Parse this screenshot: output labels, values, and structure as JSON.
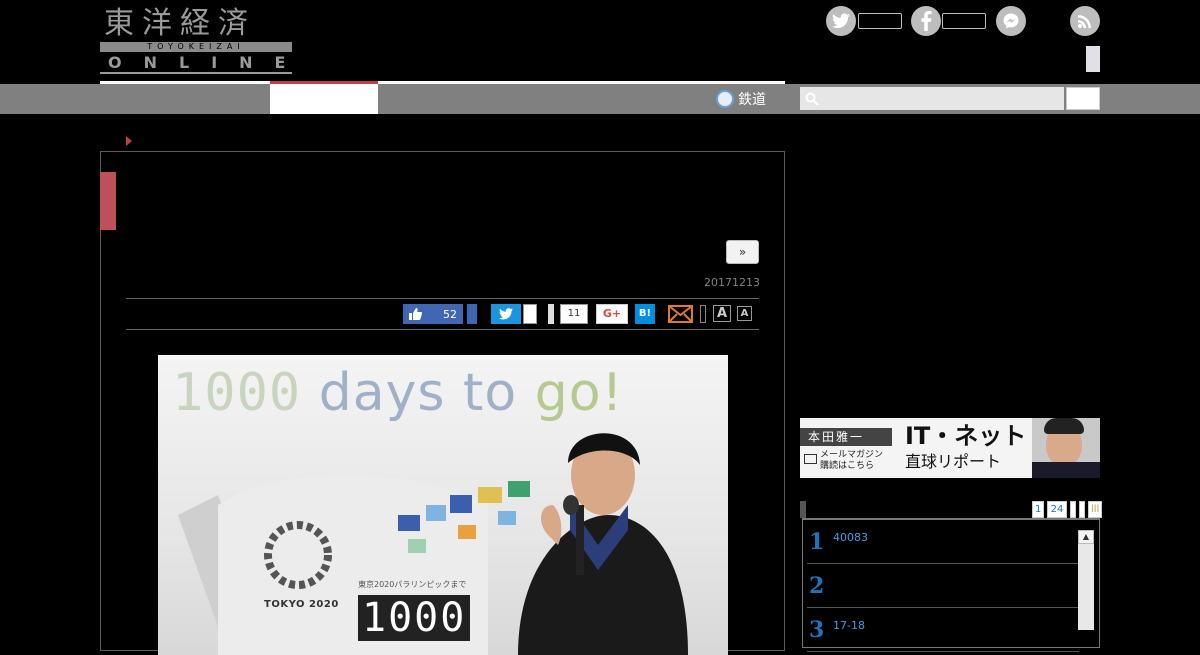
{
  "header": {
    "logo": {
      "kanji": "東洋経済",
      "romaji": "TOYOKEIZAI",
      "online": "ONLINE"
    },
    "social": {
      "twitter_icon": "twitter-icon",
      "facebook_icon": "facebook-icon",
      "messenger_icon": "messenger-icon",
      "rss_icon": "rss-icon"
    }
  },
  "nav": {
    "tetsudo_label": "鉄道",
    "search": {
      "placeholder": ""
    },
    "colors": {
      "accent": "#c0404a",
      "bar": "#808080"
    }
  },
  "article": {
    "next_label": "»",
    "date": "20171213",
    "share": {
      "like_count": "52",
      "share_count": "11",
      "gplus_label": "G+",
      "hatena_label": "B!",
      "font_large_label": "A",
      "font_small_label": "A"
    },
    "photo": {
      "headline_digits": "1000",
      "headline_days": "days to",
      "headline_go": "go!",
      "logo_caption": "TOKYO 2020",
      "counter_caption": "東京2020パラリンピックまで",
      "counter_digits": "1000"
    }
  },
  "sidebar": {
    "banner": {
      "author": "本田雅一",
      "mail_line1": "メールマガジン",
      "mail_line2": "購読はこちら",
      "title": "IT・ネット",
      "subtitle": "直球リポート"
    },
    "ranking": {
      "tabs": [
        "1",
        "24",
        "",
        "",
        "lll"
      ],
      "items": [
        {
          "rank": "1",
          "text": "40083"
        },
        {
          "rank": "2",
          "text": ""
        },
        {
          "rank": "3",
          "text": "17-18"
        }
      ]
    }
  }
}
